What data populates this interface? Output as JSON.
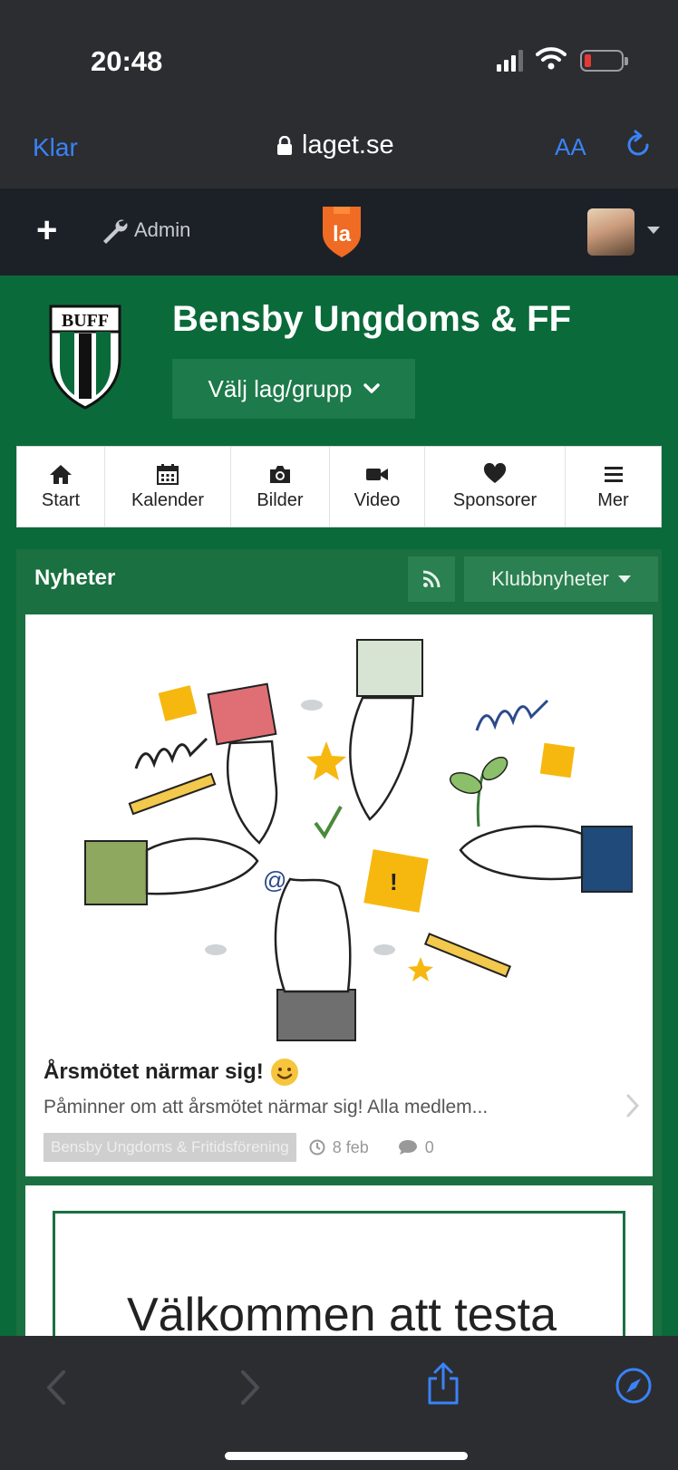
{
  "status": {
    "time": "20:48"
  },
  "browser": {
    "done_label": "Klar",
    "url": "laget.se",
    "text_size_label": "AA"
  },
  "topbar": {
    "add_label": "+",
    "admin_label": "Admin",
    "logo_text": "la"
  },
  "club": {
    "crest_text": "BUFF",
    "name": "Bensby Ungdoms & FF",
    "team_select": "Välj lag/grupp"
  },
  "nav": {
    "tabs": [
      {
        "label": "Start",
        "icon": "home-icon"
      },
      {
        "label": "Kalender",
        "icon": "calendar-icon"
      },
      {
        "label": "Bilder",
        "icon": "camera-icon"
      },
      {
        "label": "Video",
        "icon": "video-icon"
      },
      {
        "label": "Sponsorer",
        "icon": "heart-icon"
      },
      {
        "label": "Mer",
        "icon": "menu-icon"
      }
    ]
  },
  "news": {
    "title": "Nyheter",
    "filter_label": "Klubbnyheter",
    "articles": [
      {
        "title": "Årsmötet närmar sig!",
        "excerpt": "Påminner om att årsmötet närmar sig! Alla medlem...",
        "club": "Bensby Ungdoms & Fritidsförening",
        "date": "8 feb",
        "comments": "0"
      },
      {
        "title": "Välkommen att testa"
      }
    ]
  },
  "colors": {
    "club_green": "#0a6a3a",
    "ios_blue": "#3b82f6",
    "laget_orange": "#f06b23"
  }
}
